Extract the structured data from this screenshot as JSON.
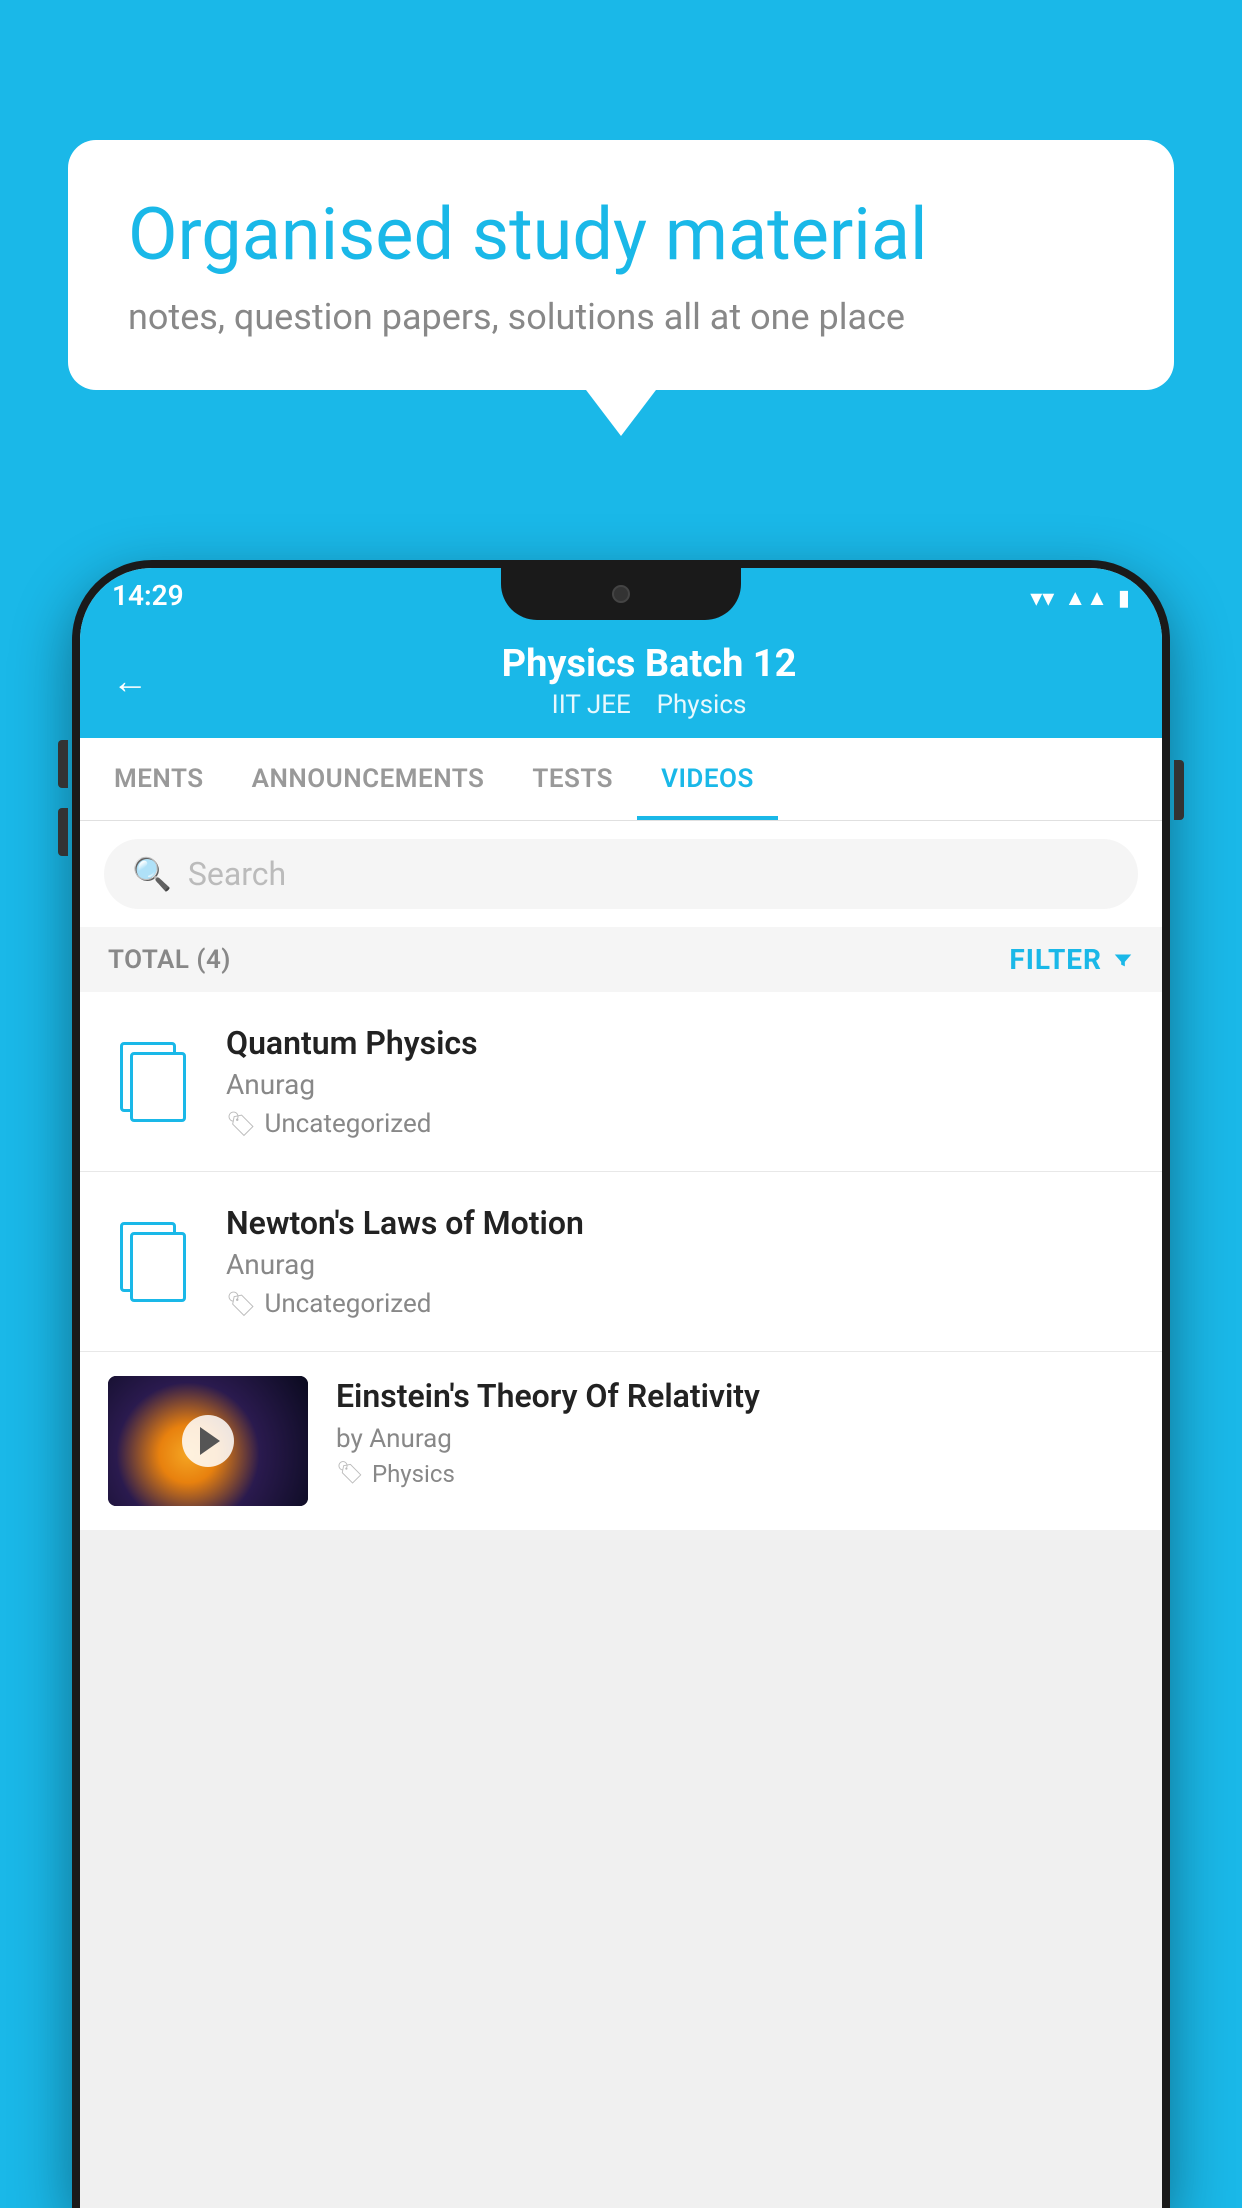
{
  "background_color": "#1ab8e8",
  "speech_bubble": {
    "headline": "Organised study material",
    "subtext": "notes, question papers, solutions all at one place"
  },
  "status_bar": {
    "time": "14:29",
    "wifi": "▼",
    "signal": "▲",
    "battery": "▮"
  },
  "app_header": {
    "back_label": "←",
    "title": "Physics Batch 12",
    "subtitle_tag1": "IIT JEE",
    "subtitle_tag2": "Physics"
  },
  "tabs": [
    {
      "label": "MENTS",
      "active": false
    },
    {
      "label": "ANNOUNCEMENTS",
      "active": false
    },
    {
      "label": "TESTS",
      "active": false
    },
    {
      "label": "VIDEOS",
      "active": true
    }
  ],
  "search": {
    "placeholder": "Search"
  },
  "filter_bar": {
    "total_label": "TOTAL (4)",
    "filter_label": "FILTER"
  },
  "videos": [
    {
      "id": 1,
      "title": "Quantum Physics",
      "author": "Anurag",
      "tag": "Uncategorized",
      "has_thumbnail": false
    },
    {
      "id": 2,
      "title": "Newton's Laws of Motion",
      "author": "Anurag",
      "tag": "Uncategorized",
      "has_thumbnail": false
    },
    {
      "id": 3,
      "title": "Einstein's Theory Of Relativity",
      "author": "by Anurag",
      "tag": "Physics",
      "has_thumbnail": true
    }
  ]
}
